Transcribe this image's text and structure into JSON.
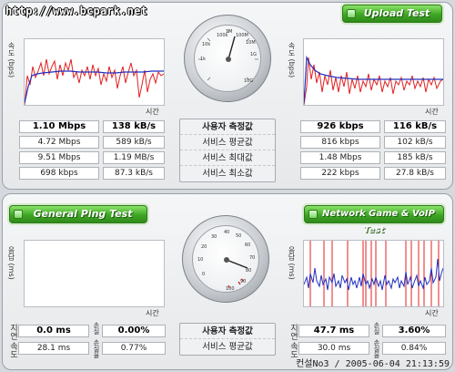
{
  "watermark": "http://www.bcpark.net",
  "buttons": {
    "upload": "Upload Test",
    "ping": "General Ping Test",
    "game": "Network Game & VoIP Test"
  },
  "axis": {
    "speed": "속도 (bps)",
    "ping_ms": "응답 (ms)",
    "time": "시간"
  },
  "speed_gauge": {
    "ticks": [
      "100k",
      "100M",
      "1M",
      "10M",
      "1G",
      "10k",
      "1k",
      "10G"
    ],
    "needle_value": "1.10 Mbps"
  },
  "ping_gauge": {
    "ticks": [
      "30",
      "40",
      "50",
      "60",
      "70",
      "80",
      "20",
      "10",
      "0",
      "100",
      "90"
    ]
  },
  "center_labels": {
    "measured": "사용자 측정값",
    "average": "서비스 평균값",
    "max": "서비스 최대값",
    "min": "서비스 최소값"
  },
  "download": {
    "rows": [
      {
        "bps": "1.10 Mbps",
        "Bps": "138 kB/s"
      },
      {
        "bps": "4.72 Mbps",
        "Bps": "589 kB/s"
      },
      {
        "bps": "9.51 Mbps",
        "Bps": "1.19 MB/s"
      },
      {
        "bps": "698 kbps",
        "Bps": "87.3 kB/s"
      }
    ]
  },
  "upload": {
    "rows": [
      {
        "bps": "926 kbps",
        "Bps": "116 kB/s"
      },
      {
        "bps": "816 kbps",
        "Bps": "102 kB/s"
      },
      {
        "bps": "1.48 Mbps",
        "Bps": "185 kB/s"
      },
      {
        "bps": "222 kbps",
        "Bps": "27.8 kB/s"
      }
    ]
  },
  "ping_labels": {
    "delay": "지연",
    "speed_word": "속도",
    "loss": "손실",
    "rate_word": "손실율"
  },
  "ping": {
    "measured_ms": "0.0 ms",
    "measured_loss": "0.00%",
    "avg_ms": "28.1 ms",
    "avg_loss": "0.77%"
  },
  "game": {
    "measured_ms": "47.7 ms",
    "measured_loss": "3.60%",
    "avg_ms": "30.0 ms",
    "avg_loss": "0.84%"
  },
  "footer": "컨설No3 / 2005-06-04 21:13:59",
  "colors": {
    "series_red": "#e02020",
    "series_blue": "#2030c0",
    "button_green": "#3ea624"
  }
}
